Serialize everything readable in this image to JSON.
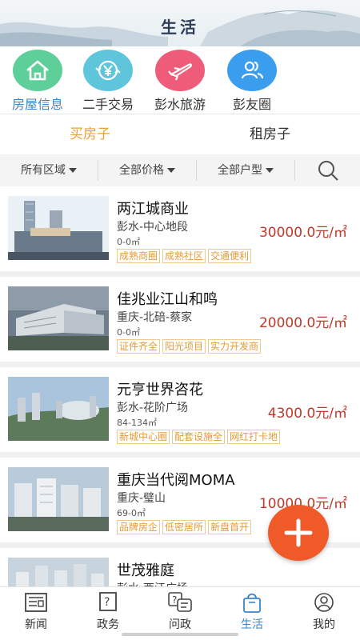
{
  "header": {
    "title": "生活"
  },
  "categories": [
    {
      "label": "房屋信息",
      "icon": "house-icon",
      "color": "#5fcf9a",
      "active": true
    },
    {
      "label": "二手交易",
      "icon": "yen-exchange-icon",
      "color": "#5fc5da",
      "active": false
    },
    {
      "label": "彭水旅游",
      "icon": "airplane-icon",
      "color": "#ef5c7a",
      "active": false
    },
    {
      "label": "彭友圈",
      "icon": "friends-icon",
      "color": "#3b9ded",
      "active": false
    }
  ],
  "tabs": {
    "buy": "买房子",
    "rent": "租房子"
  },
  "filters": {
    "region": "所有区域",
    "price": "全部价格",
    "layout": "全部户型"
  },
  "listings": [
    {
      "name": "两江城商业",
      "location": "彭水-中心地段",
      "area": "0-0㎡",
      "price": "30000.0元/㎡",
      "tags": [
        "成熟商圈",
        "成熟社区",
        "交通便利"
      ]
    },
    {
      "name": "佳兆业江山和鸣",
      "location": "重庆-北碚-蔡家",
      "area": "0-0㎡",
      "price": "20000.0元/㎡",
      "tags": [
        "证件齐全",
        "阳光项目",
        "实力开发商"
      ]
    },
    {
      "name": "元亨世界咨花",
      "location": "彭水-花阶广场",
      "area": "84-134㎡",
      "price": "4300.0元/㎡",
      "tags": [
        "新城中心圈",
        "配套设施全",
        "网红打卡地"
      ]
    },
    {
      "name": "重庆当代阅MOMA",
      "location": "重庆-璧山",
      "area": "69-0㎡",
      "price": "10000.0元/㎡",
      "tags": [
        "品牌房企",
        "低密居所",
        "新盘首开"
      ]
    },
    {
      "name": "世茂雅庭",
      "location": "彭水-西江广场",
      "area": "",
      "price": "",
      "tags": []
    }
  ],
  "bottom_nav": [
    {
      "label": "新闻",
      "icon": "news-icon",
      "active": false
    },
    {
      "label": "政务",
      "icon": "government-icon",
      "active": false
    },
    {
      "label": "问政",
      "icon": "inquiry-icon",
      "active": false
    },
    {
      "label": "生活",
      "icon": "shopping-bag-icon",
      "active": true
    },
    {
      "label": "我的",
      "icon": "profile-icon",
      "active": false
    }
  ],
  "colors": {
    "accent_blue": "#3a86c8",
    "accent_orange": "#e8a13a",
    "price_red": "#c0392b",
    "fab": "#f05a28"
  }
}
